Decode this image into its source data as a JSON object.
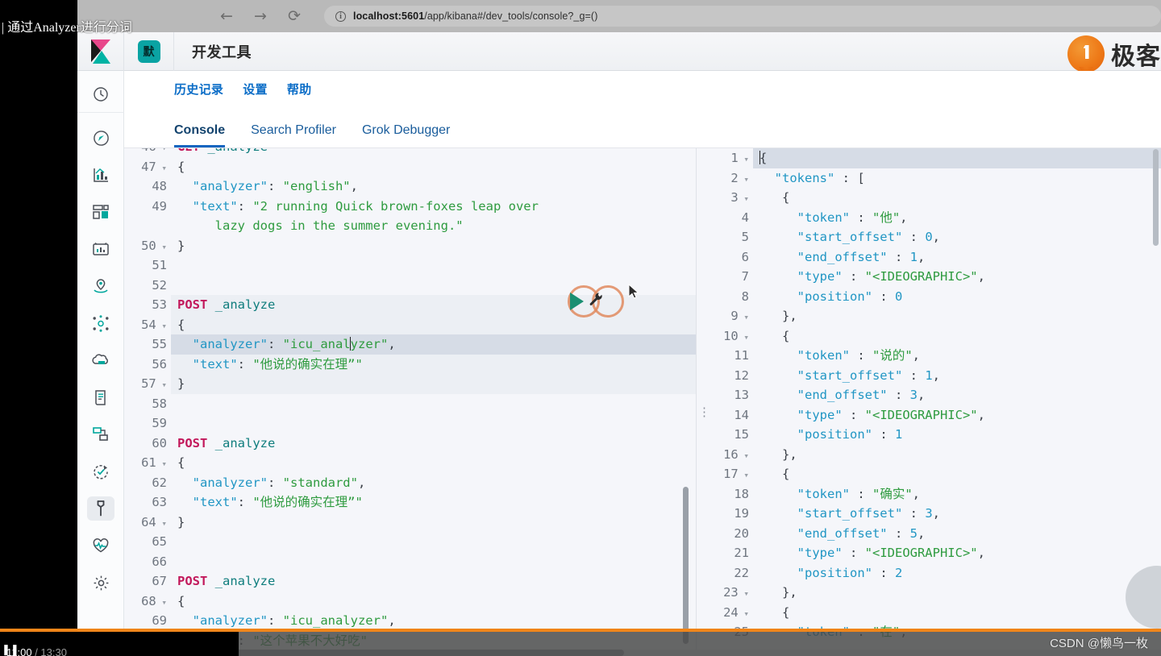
{
  "browser": {
    "back_icon": "←",
    "forward_icon": "→",
    "reload_icon": "⟳",
    "info_icon": "ⓘ",
    "url_host": "localhost:5601",
    "url_path": "/app/kibana#/dev_tools/console?_g=()"
  },
  "overlay": {
    "video_title": "| 通过Analyzer进行分词",
    "watermark": "CSDN @懒鸟一枚",
    "pause_icon": "❚❚",
    "current_time": "11:00",
    "total_time": "/ 13:30"
  },
  "header": {
    "logo_name": "kibana-logo",
    "space_badge": "默",
    "app_title": "开发工具",
    "brand_text": "极客",
    "brand_mark": "geektime-logo"
  },
  "nav_links": [
    {
      "label": "历史记录",
      "name": "history-link"
    },
    {
      "label": "设置",
      "name": "settings-link"
    },
    {
      "label": "帮助",
      "name": "help-link"
    }
  ],
  "tabs": [
    {
      "label": "Console",
      "active": true
    },
    {
      "label": "Search Profiler",
      "active": false
    },
    {
      "label": "Grok Debugger",
      "active": false
    }
  ],
  "sidebar": {
    "items": [
      {
        "icon": "clock-icon",
        "name": "sidebar-item-recently-viewed"
      },
      {
        "icon": "compass-icon",
        "name": "sidebar-item-discover"
      },
      {
        "icon": "visualize-icon",
        "name": "sidebar-item-visualize"
      },
      {
        "icon": "dashboard-icon",
        "name": "sidebar-item-dashboard"
      },
      {
        "icon": "canvas-icon",
        "name": "sidebar-item-canvas"
      },
      {
        "icon": "maps-icon",
        "name": "sidebar-item-maps"
      },
      {
        "icon": "graph-icon",
        "name": "sidebar-item-graph"
      },
      {
        "icon": "ml-icon",
        "name": "sidebar-item-machine-learning"
      },
      {
        "icon": "logs-icon",
        "name": "sidebar-item-logs"
      },
      {
        "icon": "apm-icon",
        "name": "sidebar-item-apm"
      },
      {
        "icon": "uptime-icon",
        "name": "sidebar-item-uptime"
      },
      {
        "icon": "wrench-icon",
        "name": "sidebar-item-dev-tools",
        "active": true
      },
      {
        "icon": "monitoring-icon",
        "name": "sidebar-item-monitoring"
      },
      {
        "icon": "gear-icon",
        "name": "sidebar-item-management"
      }
    ]
  },
  "editor": {
    "run_button_label": "▶",
    "wrench_button_label": "🔧",
    "lines": [
      {
        "n": "46",
        "fold": "▾",
        "cut": true,
        "segs": [
          {
            "c": "m",
            "t": "GET"
          },
          {
            "c": "u",
            "t": " _analyze"
          }
        ]
      },
      {
        "n": "47",
        "fold": "▾",
        "segs": [
          {
            "c": "p",
            "t": "{"
          }
        ]
      },
      {
        "n": "48",
        "fold": "",
        "segs": [
          {
            "c": "k",
            "t": "  \"analyzer\""
          },
          {
            "c": "p",
            "t": ": "
          },
          {
            "c": "s",
            "t": "\"english\""
          },
          {
            "c": "p",
            "t": ","
          }
        ]
      },
      {
        "n": "49",
        "fold": "",
        "tall": true,
        "segs": [
          {
            "c": "k",
            "t": "  \"text\""
          },
          {
            "c": "p",
            "t": ": "
          },
          {
            "c": "s",
            "t": "\"2 running Quick brown-foxes leap over\n     lazy dogs in the summer evening.\""
          }
        ]
      },
      {
        "n": "50",
        "fold": "▾",
        "segs": [
          {
            "c": "p",
            "t": "}"
          }
        ]
      },
      {
        "n": "51",
        "fold": "",
        "segs": []
      },
      {
        "n": "52",
        "fold": "",
        "segs": []
      },
      {
        "n": "53",
        "fold": "",
        "hl": "hlblock",
        "segs": [
          {
            "c": "m",
            "t": "POST"
          },
          {
            "c": "u",
            "t": " _analyze"
          }
        ]
      },
      {
        "n": "54",
        "fold": "▾",
        "hl": "hlblock",
        "segs": [
          {
            "c": "p",
            "t": "{"
          }
        ]
      },
      {
        "n": "55",
        "fold": "",
        "hl": "hlrow",
        "caret_after": 24,
        "segs": [
          {
            "c": "k",
            "t": "  \"analyzer\""
          },
          {
            "c": "p",
            "t": ": "
          },
          {
            "c": "s",
            "t": "\"icu_anal"
          },
          {
            "c": "caret",
            "t": ""
          },
          {
            "c": "s",
            "t": "yzer\""
          },
          {
            "c": "p",
            "t": ","
          }
        ]
      },
      {
        "n": "56",
        "fold": "",
        "hl": "hlblock",
        "segs": [
          {
            "c": "k",
            "t": "  \"text\""
          },
          {
            "c": "p",
            "t": ": "
          },
          {
            "c": "s",
            "t": "\"他说的确实在理”\""
          }
        ]
      },
      {
        "n": "57",
        "fold": "▾",
        "hl": "hlblock",
        "segs": [
          {
            "c": "p",
            "t": "}"
          }
        ]
      },
      {
        "n": "58",
        "fold": "",
        "segs": []
      },
      {
        "n": "59",
        "fold": "",
        "segs": []
      },
      {
        "n": "60",
        "fold": "",
        "segs": [
          {
            "c": "m",
            "t": "POST"
          },
          {
            "c": "u",
            "t": " _analyze"
          }
        ]
      },
      {
        "n": "61",
        "fold": "▾",
        "segs": [
          {
            "c": "p",
            "t": "{"
          }
        ]
      },
      {
        "n": "62",
        "fold": "",
        "segs": [
          {
            "c": "k",
            "t": "  \"analyzer\""
          },
          {
            "c": "p",
            "t": ": "
          },
          {
            "c": "s",
            "t": "\"standard\""
          },
          {
            "c": "p",
            "t": ","
          }
        ]
      },
      {
        "n": "63",
        "fold": "",
        "segs": [
          {
            "c": "k",
            "t": "  \"text\""
          },
          {
            "c": "p",
            "t": ": "
          },
          {
            "c": "s",
            "t": "\"他说的确实在理”\""
          }
        ]
      },
      {
        "n": "64",
        "fold": "▾",
        "segs": [
          {
            "c": "p",
            "t": "}"
          }
        ]
      },
      {
        "n": "65",
        "fold": "",
        "segs": []
      },
      {
        "n": "66",
        "fold": "",
        "segs": []
      },
      {
        "n": "67",
        "fold": "",
        "segs": [
          {
            "c": "m",
            "t": "POST"
          },
          {
            "c": "u",
            "t": " _analyze"
          }
        ]
      },
      {
        "n": "68",
        "fold": "▾",
        "segs": [
          {
            "c": "p",
            "t": "{"
          }
        ]
      },
      {
        "n": "69",
        "fold": "",
        "segs": [
          {
            "c": "k",
            "t": "  \"analyzer\""
          },
          {
            "c": "p",
            "t": ": "
          },
          {
            "c": "s",
            "t": "\"icu_analyzer\""
          },
          {
            "c": "p",
            "t": ","
          }
        ]
      },
      {
        "n": "70",
        "fold": "",
        "segs": [
          {
            "c": "k",
            "t": "  \"text\""
          },
          {
            "c": "p",
            "t": ": "
          },
          {
            "c": "s",
            "t": "\"这个苹果不大好吃\""
          }
        ]
      }
    ]
  },
  "response": {
    "lines": [
      {
        "n": "1",
        "fold": "▾",
        "hl": "hlrow",
        "caret": true,
        "ind": 0,
        "segs": [
          {
            "c": "p",
            "t": "{"
          }
        ]
      },
      {
        "n": "2",
        "fold": "▾",
        "ind": 0,
        "segs": [
          {
            "c": "k",
            "t": "  \"tokens\""
          },
          {
            "c": "p",
            "t": " : ["
          }
        ]
      },
      {
        "n": "3",
        "fold": "▾",
        "ind": 1,
        "segs": [
          {
            "c": "p",
            "t": "   {"
          }
        ]
      },
      {
        "n": "4",
        "fold": "",
        "ind": 2,
        "segs": [
          {
            "c": "k",
            "t": "     \"token\""
          },
          {
            "c": "p",
            "t": " : "
          },
          {
            "c": "s",
            "t": "\"他\""
          },
          {
            "c": "p",
            "t": ","
          }
        ]
      },
      {
        "n": "5",
        "fold": "",
        "ind": 2,
        "segs": [
          {
            "c": "k",
            "t": "     \"start_offset\""
          },
          {
            "c": "p",
            "t": " : "
          },
          {
            "c": "n",
            "t": "0"
          },
          {
            "c": "p",
            "t": ","
          }
        ]
      },
      {
        "n": "6",
        "fold": "",
        "ind": 2,
        "segs": [
          {
            "c": "k",
            "t": "     \"end_offset\""
          },
          {
            "c": "p",
            "t": " : "
          },
          {
            "c": "n",
            "t": "1"
          },
          {
            "c": "p",
            "t": ","
          }
        ]
      },
      {
        "n": "7",
        "fold": "",
        "ind": 2,
        "segs": [
          {
            "c": "k",
            "t": "     \"type\""
          },
          {
            "c": "p",
            "t": " : "
          },
          {
            "c": "s",
            "t": "\"<IDEOGRAPHIC>\""
          },
          {
            "c": "p",
            "t": ","
          }
        ]
      },
      {
        "n": "8",
        "fold": "",
        "ind": 2,
        "segs": [
          {
            "c": "k",
            "t": "     \"position\""
          },
          {
            "c": "p",
            "t": " : "
          },
          {
            "c": "n",
            "t": "0"
          }
        ]
      },
      {
        "n": "9",
        "fold": "▾",
        "ind": 1,
        "segs": [
          {
            "c": "p",
            "t": "   },"
          }
        ]
      },
      {
        "n": "10",
        "fold": "▾",
        "ind": 1,
        "segs": [
          {
            "c": "p",
            "t": "   {"
          }
        ]
      },
      {
        "n": "11",
        "fold": "",
        "ind": 2,
        "segs": [
          {
            "c": "k",
            "t": "     \"token\""
          },
          {
            "c": "p",
            "t": " : "
          },
          {
            "c": "s",
            "t": "\"说的\""
          },
          {
            "c": "p",
            "t": ","
          }
        ]
      },
      {
        "n": "12",
        "fold": "",
        "ind": 2,
        "segs": [
          {
            "c": "k",
            "t": "     \"start_offset\""
          },
          {
            "c": "p",
            "t": " : "
          },
          {
            "c": "n",
            "t": "1"
          },
          {
            "c": "p",
            "t": ","
          }
        ]
      },
      {
        "n": "13",
        "fold": "",
        "ind": 2,
        "segs": [
          {
            "c": "k",
            "t": "     \"end_offset\""
          },
          {
            "c": "p",
            "t": " : "
          },
          {
            "c": "n",
            "t": "3"
          },
          {
            "c": "p",
            "t": ","
          }
        ]
      },
      {
        "n": "14",
        "fold": "",
        "ind": 2,
        "segs": [
          {
            "c": "k",
            "t": "     \"type\""
          },
          {
            "c": "p",
            "t": " : "
          },
          {
            "c": "s",
            "t": "\"<IDEOGRAPHIC>\""
          },
          {
            "c": "p",
            "t": ","
          }
        ]
      },
      {
        "n": "15",
        "fold": "",
        "ind": 2,
        "segs": [
          {
            "c": "k",
            "t": "     \"position\""
          },
          {
            "c": "p",
            "t": " : "
          },
          {
            "c": "n",
            "t": "1"
          }
        ]
      },
      {
        "n": "16",
        "fold": "▾",
        "ind": 1,
        "segs": [
          {
            "c": "p",
            "t": "   },"
          }
        ]
      },
      {
        "n": "17",
        "fold": "▾",
        "ind": 1,
        "segs": [
          {
            "c": "p",
            "t": "   {"
          }
        ]
      },
      {
        "n": "18",
        "fold": "",
        "ind": 2,
        "segs": [
          {
            "c": "k",
            "t": "     \"token\""
          },
          {
            "c": "p",
            "t": " : "
          },
          {
            "c": "s",
            "t": "\"确实\""
          },
          {
            "c": "p",
            "t": ","
          }
        ]
      },
      {
        "n": "19",
        "fold": "",
        "ind": 2,
        "segs": [
          {
            "c": "k",
            "t": "     \"start_offset\""
          },
          {
            "c": "p",
            "t": " : "
          },
          {
            "c": "n",
            "t": "3"
          },
          {
            "c": "p",
            "t": ","
          }
        ]
      },
      {
        "n": "20",
        "fold": "",
        "ind": 2,
        "segs": [
          {
            "c": "k",
            "t": "     \"end_offset\""
          },
          {
            "c": "p",
            "t": " : "
          },
          {
            "c": "n",
            "t": "5"
          },
          {
            "c": "p",
            "t": ","
          }
        ]
      },
      {
        "n": "21",
        "fold": "",
        "ind": 2,
        "segs": [
          {
            "c": "k",
            "t": "     \"type\""
          },
          {
            "c": "p",
            "t": " : "
          },
          {
            "c": "s",
            "t": "\"<IDEOGRAPHIC>\""
          },
          {
            "c": "p",
            "t": ","
          }
        ]
      },
      {
        "n": "22",
        "fold": "",
        "ind": 2,
        "segs": [
          {
            "c": "k",
            "t": "     \"position\""
          },
          {
            "c": "p",
            "t": " : "
          },
          {
            "c": "n",
            "t": "2"
          }
        ]
      },
      {
        "n": "23",
        "fold": "▾",
        "ind": 1,
        "segs": [
          {
            "c": "p",
            "t": "   },"
          }
        ]
      },
      {
        "n": "24",
        "fold": "▾",
        "ind": 1,
        "segs": [
          {
            "c": "p",
            "t": "   {"
          }
        ]
      },
      {
        "n": "25",
        "fold": "",
        "ind": 2,
        "segs": [
          {
            "c": "k",
            "t": "     \"token\""
          },
          {
            "c": "p",
            "t": " : "
          },
          {
            "c": "s",
            "t": "\"在\""
          },
          {
            "c": "p",
            "t": ","
          }
        ]
      }
    ]
  }
}
